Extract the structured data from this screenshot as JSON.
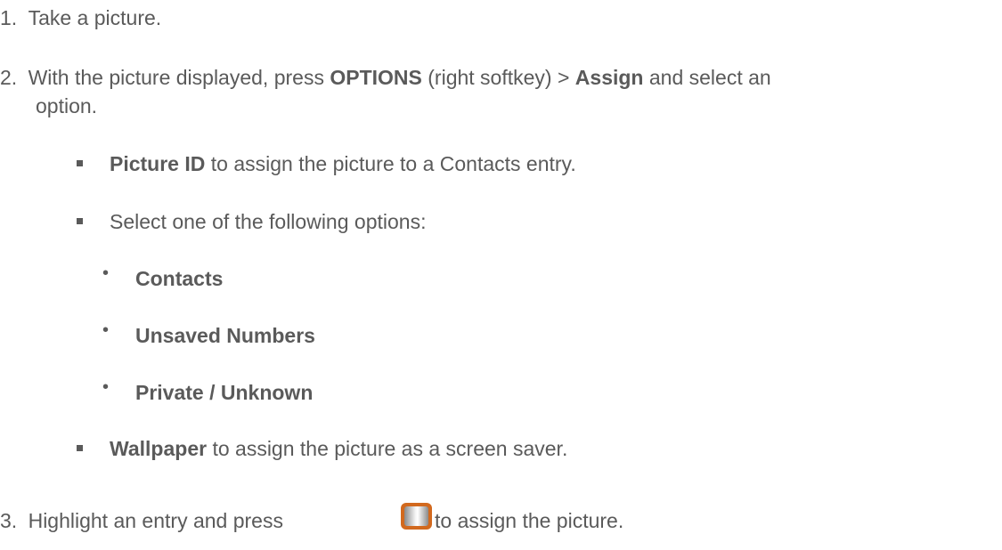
{
  "steps": [
    {
      "number": "1.",
      "text": "Take a picture."
    },
    {
      "number": "2.",
      "text_before": "With the picture displayed, press ",
      "bold1": "OPTIONS",
      "text_mid": " (right softkey) > ",
      "bold2": "Assign",
      "text_after": " and select an",
      "text_cont": "option."
    },
    {
      "number": "3.",
      "text_before": "Highlight an entry and press ",
      "text_after": " to assign the picture.",
      "key_icon": "ok-key-icon"
    }
  ],
  "sub_items": [
    {
      "bold": "Picture ID",
      "text": " to assign the picture to a Contacts entry."
    },
    {
      "bold": "",
      "text": "Select one of the following options:"
    },
    {
      "bold": "Wallpaper",
      "text": " to assign the picture as a screen saver."
    }
  ],
  "options": [
    "Contacts",
    "Unsaved Numbers",
    "Private / Unknown"
  ],
  "colors": {
    "text": "#5a5a5a",
    "key_border": "#d2691e"
  }
}
